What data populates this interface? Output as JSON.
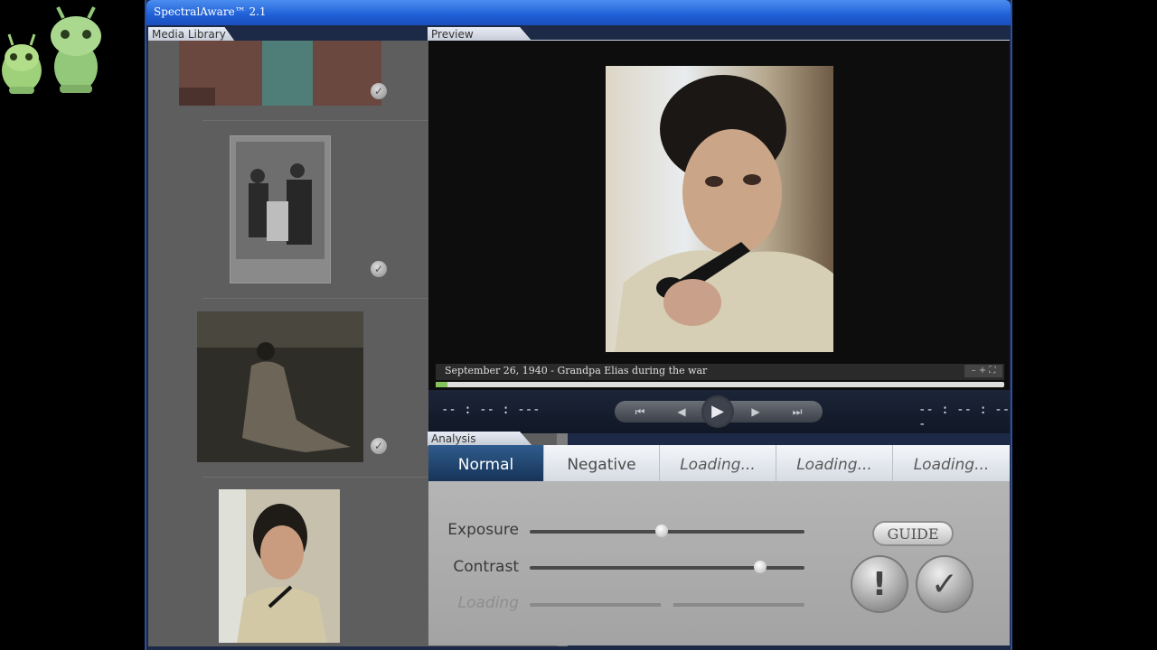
{
  "window": {
    "title": "SpectralAware™ 2.1"
  },
  "panels": {
    "library": "Media Library",
    "preview": "Preview",
    "analysis": "Analysis"
  },
  "library": {
    "items": [
      {
        "name": "photo-1",
        "checked": true
      },
      {
        "name": "photo-2",
        "checked": true
      },
      {
        "name": "photo-3",
        "checked": true
      },
      {
        "name": "photo-4",
        "checked": false
      }
    ],
    "check_glyph": "✓"
  },
  "preview": {
    "caption": "September 26, 1940 - Grandpa Elias during the war",
    "zoom": "– + ⛶",
    "progress": 0.02,
    "time_left": "-- : -- : ---",
    "time_right": "-- : -- : ---"
  },
  "transport": {
    "first": "⏮",
    "prev": "◀",
    "play": "▶",
    "next": "▶",
    "last": "⏭"
  },
  "analysis": {
    "tabs": [
      {
        "label": "Normal",
        "active": true
      },
      {
        "label": "Negative",
        "active": false
      },
      {
        "label": "Loading...",
        "active": false
      },
      {
        "label": "Loading...",
        "active": false
      },
      {
        "label": "Loading...",
        "active": false
      }
    ],
    "sliders": [
      {
        "label": "Exposure",
        "value": 0.48,
        "enabled": true
      },
      {
        "label": "Contrast",
        "value": 0.84,
        "enabled": true
      },
      {
        "label": "Loading",
        "value": 0.5,
        "enabled": false
      }
    ],
    "guide": "GUIDE",
    "warn": "!",
    "ok": "✓"
  },
  "colors": {
    "accent": "#1f5fd6",
    "active_tab": "#2f5b8d",
    "progress": "#86c25b"
  }
}
